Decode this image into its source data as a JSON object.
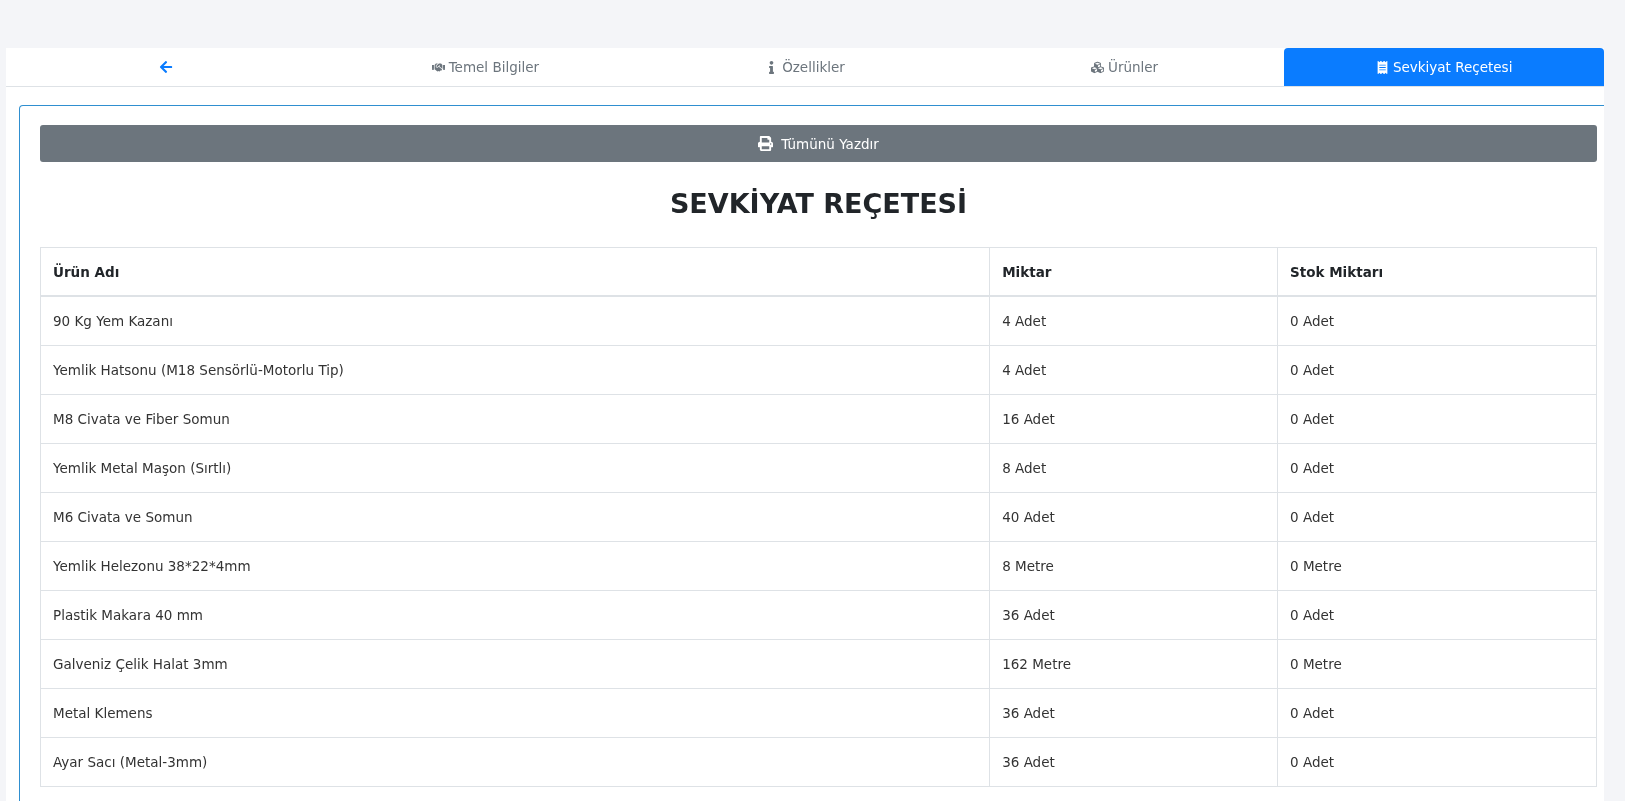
{
  "tabs": [
    {
      "kind": "back",
      "selected": false
    },
    {
      "kind": "handshake",
      "label": "Temel Bilgiler",
      "selected": false
    },
    {
      "kind": "info",
      "label": "Özellikler",
      "selected": false
    },
    {
      "kind": "boxes",
      "label": "Ürünler",
      "selected": false
    },
    {
      "kind": "receipt",
      "label": "Sevkiyat Reçetesi",
      "selected": true
    }
  ],
  "print_button": "Tümünü Yazdır",
  "title": "SEVKİYAT REÇETESİ",
  "table": {
    "columns": [
      "Ürün Adı",
      "Miktar",
      "Stok Miktarı"
    ],
    "rows": [
      [
        "90 Kg Yem Kazanı",
        "4 Adet",
        "0 Adet"
      ],
      [
        "Yemlik Hatsonu (M18 Sensörlü-Motorlu Tip)",
        "4 Adet",
        "0 Adet"
      ],
      [
        "M8 Civata ve Fiber Somun",
        "16 Adet",
        "0 Adet"
      ],
      [
        "Yemlik Metal Maşon (Sırtlı)",
        "8 Adet",
        "0 Adet"
      ],
      [
        "M6 Civata ve Somun",
        "40 Adet",
        "0 Adet"
      ],
      [
        "Yemlik Helezonu 38*22*4mm",
        "8 Metre",
        "0 Metre"
      ],
      [
        "Plastik Makara 40 mm",
        "36 Adet",
        "0 Adet"
      ],
      [
        "Galveniz Çelik Halat 3mm",
        "162 Metre",
        "0 Metre"
      ],
      [
        "Metal Klemens",
        "36 Adet",
        "0 Adet"
      ],
      [
        "Ayar Sacı (Metal-3mm)",
        "36 Adet",
        "0 Adet"
      ]
    ]
  }
}
